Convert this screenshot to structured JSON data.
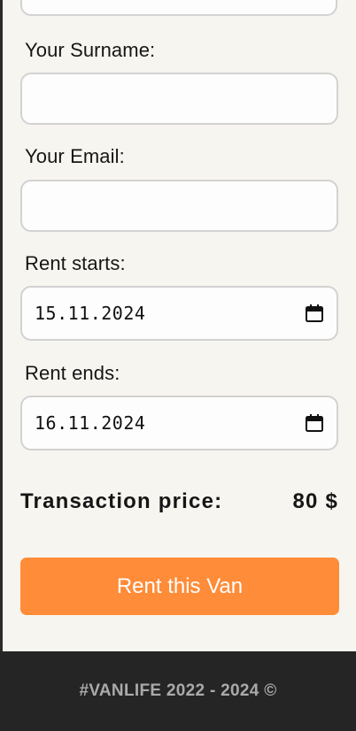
{
  "form": {
    "surname_label": "Your Surname:",
    "surname_value": "",
    "email_label": "Your Email:",
    "email_value": "",
    "rent_start_label": "Rent starts:",
    "rent_start_value": "15.11.2024",
    "rent_end_label": "Rent ends:",
    "rent_end_value": "16.11.2024",
    "calendar_icon": "calendar-icon"
  },
  "transaction": {
    "label": "Transaction price:",
    "value": "80 $"
  },
  "actions": {
    "rent_button_label": "Rent this Van",
    "accent_color": "#ff8c38"
  },
  "footer": {
    "text": "#VANLIFE 2022 - 2024 ©"
  }
}
